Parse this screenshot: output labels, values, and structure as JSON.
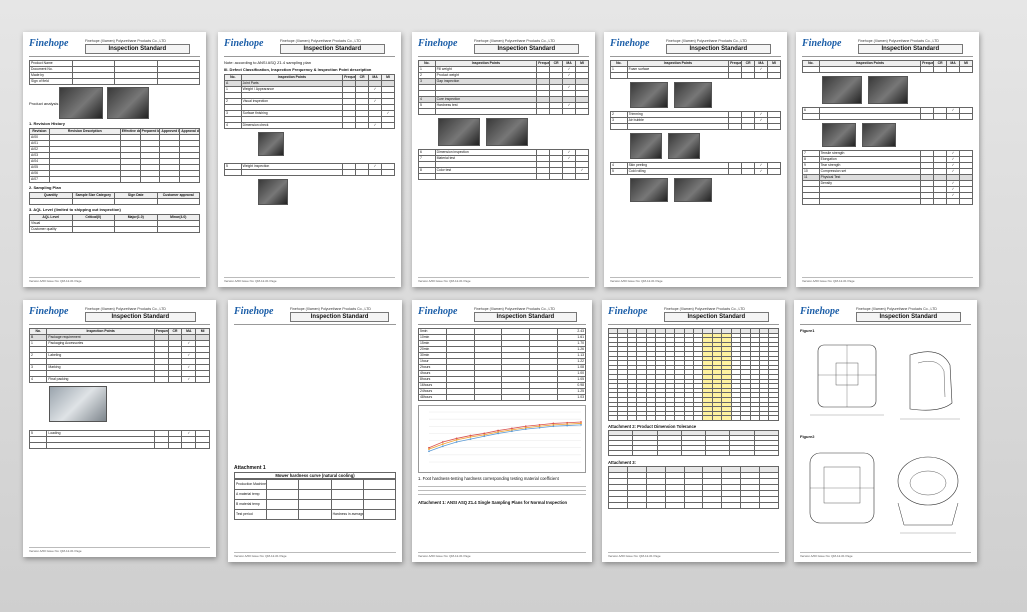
{
  "company": "Finehope",
  "company_sub": "Finehope (Xiamen) Polyurethane Products Co., LTD",
  "doc_title": "Inspection Standard",
  "footer": "Version A/00    Issue No: QM-12-01                                        Page",
  "page1": {
    "section_1": "1. Revision History",
    "section_2": "2. Sampling Plan",
    "section_3": "3. AQL Level (limited to shipping out inspection)",
    "product_analysis": "Product analysis",
    "rows": [
      "Product Name",
      "Document No.",
      "Made by",
      "Sign of field"
    ],
    "rev_head": [
      "Revision",
      "Revision Description",
      "Effective date",
      "Prepared by",
      "Approved by",
      "Approval date"
    ],
    "rev_codes": [
      "A/00",
      "A/01",
      "A/02",
      "A/03",
      "A/04",
      "A/05",
      "A/06",
      "A/07"
    ],
    "sample_head": [
      "Quantity",
      "Sample Size Category",
      "Sign Date",
      "Customer approval"
    ],
    "aql_head": [
      "AQL Level",
      "Critical(0)",
      "Major(1.0)",
      "Minor(4.0)"
    ],
    "aql_rows": [
      "Visual",
      "Customer quality"
    ]
  },
  "page2": {
    "note": "Note: according to ANSI ASQ Z1.4 sampling plan",
    "section": "III. Defect Classification, Inspection Frequency & Inspection Point description",
    "col_no": "No.",
    "col_points": "Inspection Points",
    "col_freq": "Frequency",
    "col_class": "Classification",
    "class_cols": [
      "CR",
      "MA",
      "MI"
    ],
    "items": [
      "Joint Parts",
      "Weight / Appearance",
      "Visual inspection",
      "Surface finishing",
      "Dimension check",
      "Weight inspection"
    ]
  },
  "page3": {
    "items": [
      "Fill weight",
      "Product weight",
      "Gap inspection",
      "Cure inspection",
      "Hardness test",
      "Dimension inspection",
      "Material test",
      "Color test"
    ]
  },
  "page4": {
    "items": [
      "Foam surface",
      "Trimming",
      "Air bubble",
      "Skin peeling",
      "Cold rolling"
    ]
  },
  "page5": {
    "items": [
      "Tensile strength",
      "Elongation",
      "Tear strength",
      "Compression set",
      "Physical Test",
      "Density"
    ]
  },
  "page6": {
    "items": [
      "Package requirement",
      "Packaging Accessories",
      "Labeling",
      "Marking",
      "Final packing",
      "Loading"
    ]
  },
  "page7": {
    "attachment": "Attachment 1",
    "curve_title": "Mower hardness curve (natural cooling)",
    "rows": [
      "Production Machine",
      "A material temp",
      "B material temp",
      "Test period",
      "Hardness in average"
    ]
  },
  "page8": {
    "times": [
      "5min",
      "10min",
      "15min",
      "20min",
      "30min",
      "1hour",
      "2hours",
      "4hours",
      "8hours",
      "16hours",
      "24hours",
      "48hours"
    ],
    "values": [
      "2.43",
      "1.61",
      "1.70",
      "1.26",
      "1.13",
      "1.22",
      "1.08",
      "1.00",
      "1.05",
      "0.98",
      "1.25",
      "1.03"
    ],
    "note1": "1. Foot hardness-testing hardness corresponding testing material coefficient",
    "attachment": "Attachment 1: ANSI ASQ Z1.4 Single Sampling Plans for Normal Inspection"
  },
  "page9": {
    "attachment_2": "Attachment 2: Product Dimension Tolerance",
    "attachment_3": "Attachment 3:"
  },
  "page10": {
    "fig1": "Figure1",
    "fig2": "Figure2"
  },
  "chart_data": {
    "type": "line",
    "series": [
      {
        "values": [
          20,
          28,
          33,
          37,
          40,
          44,
          47,
          50,
          52,
          54,
          55,
          56
        ]
      },
      {
        "values": [
          18,
          25,
          31,
          35,
          38,
          42,
          45,
          48,
          50,
          52,
          53,
          54
        ]
      },
      {
        "values": [
          15,
          22,
          28,
          32,
          36,
          40,
          43,
          46,
          48,
          50,
          51,
          52
        ]
      }
    ],
    "ylim": [
      0,
      70
    ],
    "colors": [
      "#d9534f",
      "#f0a030",
      "#5b9bd5"
    ]
  }
}
